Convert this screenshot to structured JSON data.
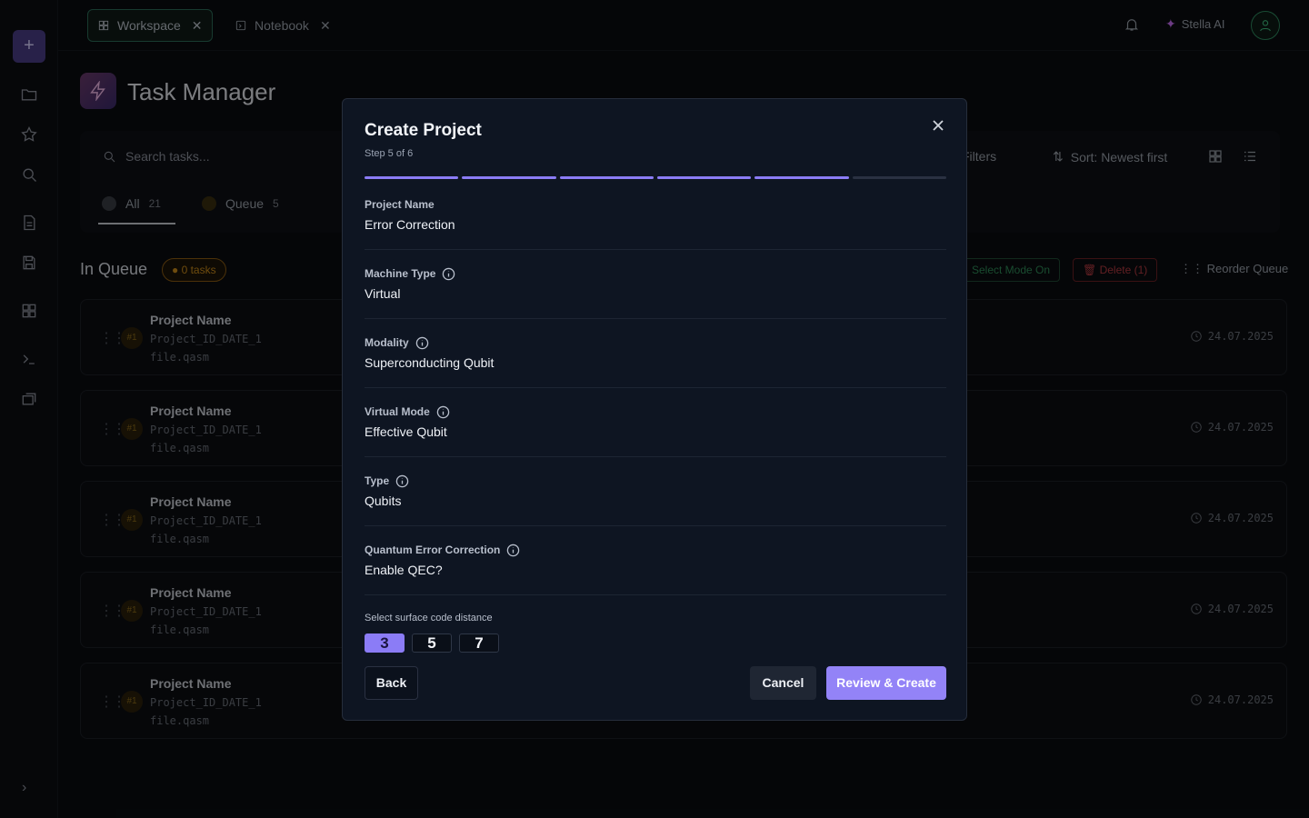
{
  "tabs": [
    {
      "label": "Workspace",
      "active": true
    },
    {
      "label": "Notebook",
      "active": false
    }
  ],
  "header": {
    "assistant_label": "Stella AI"
  },
  "page": {
    "title": "Task Manager",
    "search_placeholder": "Search tasks...",
    "filters_label": "Filters",
    "sort_label": "Sort: Newest first",
    "filter_tabs": [
      {
        "label": "All",
        "count": "21"
      },
      {
        "label": "Queue",
        "count": "5"
      }
    ],
    "queue_title": "In Queue",
    "queue_badge": "0 tasks",
    "select_mode_label": "Select Mode On",
    "delete_label": "Delete (1)",
    "reorder_label": "Reorder Queue",
    "cards": [
      {
        "num": "#1",
        "name": "Project Name",
        "id": "Project_ID_DATE_1",
        "file": "file.qasm",
        "date": "24.07.2025"
      },
      {
        "num": "#1",
        "name": "Project Name",
        "id": "Project_ID_DATE_1",
        "file": "file.qasm",
        "date": "24.07.2025"
      },
      {
        "num": "#1",
        "name": "Project Name",
        "id": "Project_ID_DATE_1",
        "file": "file.qasm",
        "date": "24.07.2025"
      },
      {
        "num": "#1",
        "name": "Project Name",
        "id": "Project_ID_DATE_1",
        "file": "file.qasm",
        "date": "24.07.2025"
      },
      {
        "num": "#1",
        "name": "Project Name",
        "id": "Project_ID_DATE_1",
        "file": "file.qasm",
        "date": "24.07.2025"
      }
    ]
  },
  "modal": {
    "title": "Create Project",
    "step": "Step 5 of 6",
    "progress": {
      "current": 5,
      "total": 6
    },
    "fields": [
      {
        "label": "Project Name",
        "value": "Error Correction",
        "info": false
      },
      {
        "label": "Machine Type",
        "value": "Virtual",
        "info": true
      },
      {
        "label": "Modality",
        "value": "Superconducting Qubit",
        "info": true
      },
      {
        "label": "Virtual Mode",
        "value": "Effective Qubit",
        "info": true
      },
      {
        "label": "Type",
        "value": "Qubits",
        "info": true
      },
      {
        "label": "Quantum Error Correction",
        "value": "Enable QEC?",
        "info": true
      }
    ],
    "distance_label": "Select surface code distance",
    "distances": [
      "3",
      "5",
      "7"
    ],
    "selected_distance": "3",
    "back_label": "Back",
    "cancel_label": "Cancel",
    "create_label": "Review & Create"
  },
  "colors": {
    "accent": "#8b7cf6",
    "modal_bg": "#0e1522",
    "page_bg": "#0a0c10"
  }
}
